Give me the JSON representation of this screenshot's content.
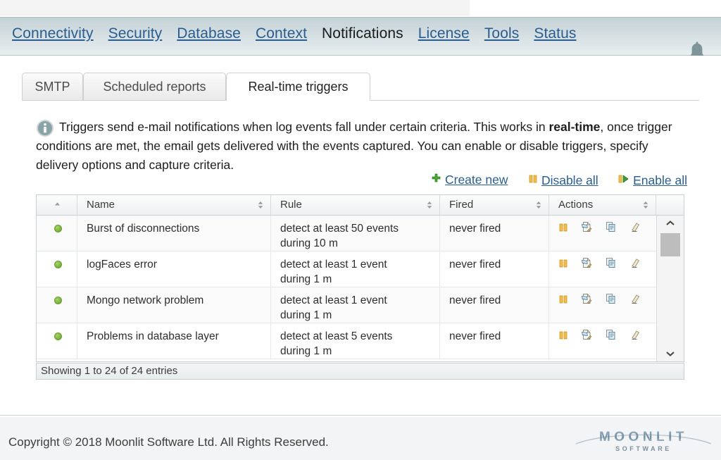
{
  "nav": {
    "items": [
      {
        "label": "Connectivity",
        "active": false
      },
      {
        "label": "Security",
        "active": false
      },
      {
        "label": "Database",
        "active": false
      },
      {
        "label": "Context",
        "active": false
      },
      {
        "label": "Notifications",
        "active": true
      },
      {
        "label": "License",
        "active": false
      },
      {
        "label": "Tools",
        "active": false
      },
      {
        "label": "Status",
        "active": false
      }
    ],
    "bell_icon": "bell-icon"
  },
  "tabs": [
    {
      "label": "SMTP",
      "active": false
    },
    {
      "label": "Scheduled reports",
      "active": false
    },
    {
      "label": "Real-time triggers",
      "active": true
    }
  ],
  "info": {
    "icon": "info-icon",
    "text_part1": "Triggers send e-mail notifications when log events fall under certain criteria. This works in ",
    "emphasis": "real-time",
    "text_part2": ", once trigger conditions are met, the email gets delivered with the events captured. You can enable or disable triggers, specify delivery options and capture criteria."
  },
  "action_links": [
    {
      "label": "Create new",
      "icon": "plus-icon"
    },
    {
      "label": "Disable all",
      "icon": "pause-icon"
    },
    {
      "label": "Enable all",
      "icon": "pause-play-icon"
    }
  ],
  "table": {
    "headers": [
      {
        "key": "status",
        "label": "",
        "sort": "asc"
      },
      {
        "key": "name",
        "label": "Name",
        "sort": "none"
      },
      {
        "key": "rule",
        "label": "Rule",
        "sort": "none"
      },
      {
        "key": "fired",
        "label": "Fired",
        "sort": "none"
      },
      {
        "key": "actions",
        "label": "Actions",
        "sort": "none"
      }
    ],
    "rows": [
      {
        "status": "enabled",
        "name": "Burst of disconnections",
        "rule_line1": "detect at least 50 events",
        "rule_line2": "during 10 m",
        "fired": "never fired"
      },
      {
        "status": "enabled",
        "name": "logFaces error",
        "rule_line1": "detect at least 1 event",
        "rule_line2": "during 1 m",
        "fired": "never fired"
      },
      {
        "status": "enabled",
        "name": "Mongo network problem",
        "rule_line1": "detect at least 1 event",
        "rule_line2": "during 1 m",
        "fired": "never fired"
      },
      {
        "status": "enabled",
        "name": "Problems in database layer",
        "rule_line1": "detect at least 5 events",
        "rule_line2": "during 1 m",
        "fired": "never fired"
      }
    ],
    "row_action_icons": [
      "pause-icon",
      "test-trigger-icon",
      "copy-icon",
      "erase-icon"
    ],
    "status_text": "Showing 1 to 24 of 24 entries"
  },
  "footer": {
    "copyright": "Copyright © 2018 Moonlit Software Ltd. All Rights Reserved.",
    "logo_text": "MOONLIT",
    "logo_subtext": "SOFTWARE"
  },
  "colors": {
    "link": "#2a5d8f",
    "status_enabled": "#7fb83f",
    "accent_orange": "#e8a33d",
    "nav_bg": "#ccd8dc"
  }
}
